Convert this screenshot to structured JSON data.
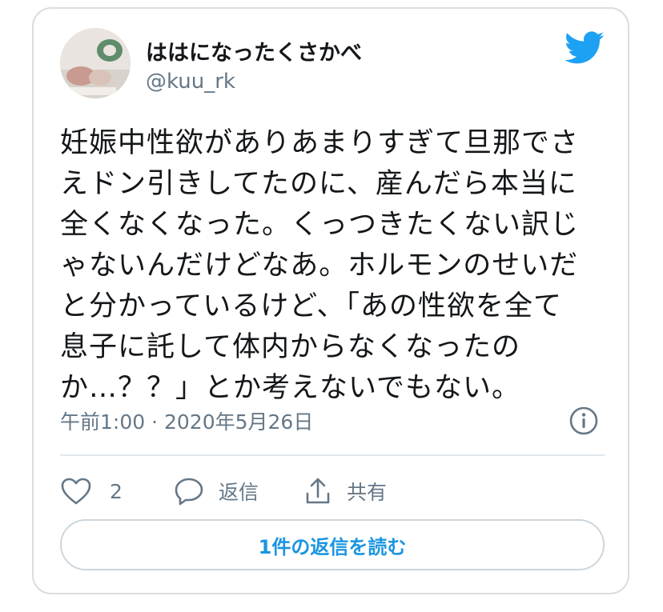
{
  "tweet": {
    "author": {
      "display_name": "ははになったくさかべ",
      "handle": "@kuu_rk"
    },
    "body_lines": [
      "妊娠中性欲がありあまりすぎて旦那でさ",
      "えドン引きしてたのに、産んだら本当に",
      "全くなくなった。くっつきたくない訳じ",
      "ゃないんだけどなあ。ホルモンのせいだ",
      "と分かっているけど、「あの性欲を全て",
      "息子に託して体内からなくなったの",
      "か…？？」とか考えないでもない。"
    ],
    "timestamp": "午前1:00 · 2020年5月26日",
    "actions": {
      "like_count": "2",
      "reply_label": "返信",
      "share_label": "共有"
    },
    "read_replies_label": "1件の返信を読む"
  },
  "icons": {
    "brand": "twitter-bird-icon",
    "info": "info-icon",
    "like": "heart-icon",
    "reply": "speech-bubble-icon",
    "share": "share-icon"
  },
  "colors": {
    "twitter_blue": "#1da1f2",
    "link_blue": "#1b95e0",
    "text": "#14171a",
    "secondary_text": "#657786",
    "border": "#d9dde1"
  }
}
